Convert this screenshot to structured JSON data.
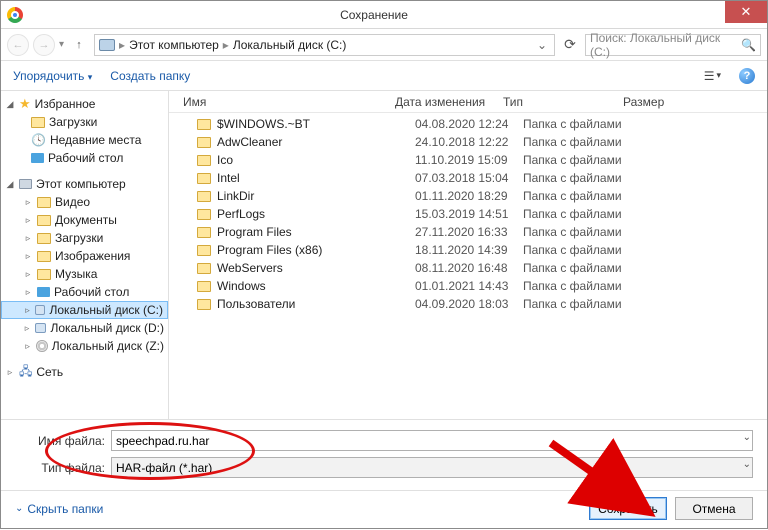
{
  "window": {
    "title": "Сохранение"
  },
  "breadcrumb": {
    "root": "Этот компьютер",
    "current": "Локальный диск (C:)"
  },
  "search": {
    "placeholder": "Поиск: Локальный диск (C:)"
  },
  "toolbar": {
    "organize": "Упорядочить",
    "newfolder": "Создать папку"
  },
  "columns": {
    "name": "Имя",
    "date": "Дата изменения",
    "type": "Тип",
    "size": "Размер"
  },
  "sidebar": {
    "favorites": "Избранное",
    "downloads": "Загрузки",
    "recent": "Недавние места",
    "desktop": "Рабочий стол",
    "computer": "Этот компьютер",
    "video": "Видео",
    "documents": "Документы",
    "downloads2": "Загрузки",
    "pictures": "Изображения",
    "music": "Музыка",
    "desktop2": "Рабочий стол",
    "driveC": "Локальный диск (C:)",
    "driveD": "Локальный диск (D:)",
    "driveZ": "Локальный диск (Z:)",
    "network": "Сеть"
  },
  "files": [
    {
      "name": "$WINDOWS.~BT",
      "date": "04.08.2020 12:24",
      "type": "Папка с файлами"
    },
    {
      "name": "AdwCleaner",
      "date": "24.10.2018 12:22",
      "type": "Папка с файлами"
    },
    {
      "name": "Ico",
      "date": "11.10.2019 15:09",
      "type": "Папка с файлами"
    },
    {
      "name": "Intel",
      "date": "07.03.2018 15:04",
      "type": "Папка с файлами"
    },
    {
      "name": "LinkDir",
      "date": "01.11.2020 18:29",
      "type": "Папка с файлами"
    },
    {
      "name": "PerfLogs",
      "date": "15.03.2019 14:51",
      "type": "Папка с файлами"
    },
    {
      "name": "Program Files",
      "date": "27.11.2020 16:33",
      "type": "Папка с файлами"
    },
    {
      "name": "Program Files (x86)",
      "date": "18.11.2020 14:39",
      "type": "Папка с файлами"
    },
    {
      "name": "WebServers",
      "date": "08.11.2020 16:48",
      "type": "Папка с файлами"
    },
    {
      "name": "Windows",
      "date": "01.01.2021 14:43",
      "type": "Папка с файлами"
    },
    {
      "name": "Пользователи",
      "date": "04.09.2020 18:03",
      "type": "Папка с файлами"
    }
  ],
  "form": {
    "name_label": "Имя файла:",
    "name_value": "speechpad.ru.har",
    "type_label": "Тип файла:",
    "type_value": "HAR-файл (*.har)"
  },
  "footer": {
    "hide": "Скрыть папки",
    "save": "Сохранить",
    "cancel": "Отмена"
  }
}
